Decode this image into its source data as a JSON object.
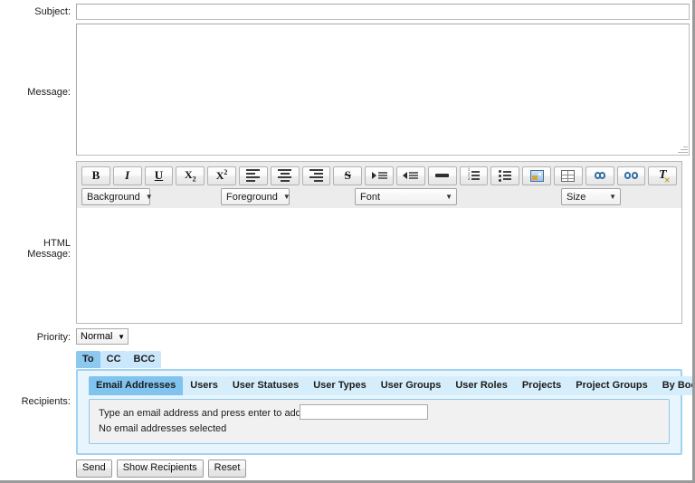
{
  "form": {
    "subject": {
      "label": "Subject:",
      "value": "",
      "placeholder": ""
    },
    "message": {
      "label": "Message:",
      "value": "",
      "placeholder": ""
    },
    "html_message": {
      "label": "HTML Message:",
      "value": ""
    },
    "priority": {
      "label": "Priority:",
      "value": "Normal",
      "caret": "▼"
    },
    "recipients": {
      "label": "Recipients:"
    }
  },
  "editor": {
    "buttons": [
      {
        "name": "bold-icon",
        "label": "B",
        "title": "Bold"
      },
      {
        "name": "italic-icon",
        "label": "I",
        "title": "Italic"
      },
      {
        "name": "underline-icon",
        "label": "U",
        "title": "Underline"
      },
      {
        "name": "subscript-icon",
        "label": "X2",
        "title": "Subscript"
      },
      {
        "name": "superscript-icon",
        "label": "X2",
        "title": "Superscript"
      },
      {
        "name": "align-left-icon",
        "label": "",
        "title": "Align Left"
      },
      {
        "name": "align-center-icon",
        "label": "",
        "title": "Align Center"
      },
      {
        "name": "align-right-icon",
        "label": "",
        "title": "Align Right"
      },
      {
        "name": "strikethrough-icon",
        "label": "S",
        "title": "Strikethrough"
      },
      {
        "name": "indent-icon",
        "label": "",
        "title": "Indent"
      },
      {
        "name": "outdent-icon",
        "label": "",
        "title": "Outdent"
      },
      {
        "name": "horizontal-rule-icon",
        "label": "",
        "title": "Horizontal Rule"
      },
      {
        "name": "numbered-list-icon",
        "label": "",
        "title": "Numbered List"
      },
      {
        "name": "bulleted-list-icon",
        "label": "",
        "title": "Bulleted List"
      },
      {
        "name": "insert-image-icon",
        "label": "",
        "title": "Insert Image"
      },
      {
        "name": "insert-table-icon",
        "label": "",
        "title": "Insert Table"
      },
      {
        "name": "insert-link-icon",
        "label": "",
        "title": "Insert Link"
      },
      {
        "name": "remove-link-icon",
        "label": "",
        "title": "Remove Link"
      },
      {
        "name": "remove-format-icon",
        "label": "T",
        "title": "Remove Formatting"
      }
    ],
    "selects": {
      "background": "Background",
      "foreground": "Foreground",
      "font": "Font",
      "size": "Size",
      "caret": "▼"
    }
  },
  "recipient_tabs": [
    {
      "label": "To",
      "active": true
    },
    {
      "label": "CC",
      "active": false
    },
    {
      "label": "BCC",
      "active": false
    }
  ],
  "recipient_subtabs": [
    {
      "label": "Email Addresses",
      "active": true
    },
    {
      "label": "Users",
      "active": false
    },
    {
      "label": "User Statuses",
      "active": false
    },
    {
      "label": "User Types",
      "active": false
    },
    {
      "label": "User Groups",
      "active": false
    },
    {
      "label": "User Roles",
      "active": false
    },
    {
      "label": "Projects",
      "active": false
    },
    {
      "label": "Project Groups",
      "active": false
    },
    {
      "label": "By Bookings",
      "active": false
    }
  ],
  "email_panel": {
    "hint": "Type an email address and press enter to add it",
    "input_value": "",
    "status": "No email addresses selected"
  },
  "actions": [
    {
      "name": "send-button",
      "label": "Send"
    },
    {
      "name": "show-recipients-button",
      "label": "Show Recipients"
    },
    {
      "name": "reset-button",
      "label": "Reset"
    }
  ],
  "colors": {
    "tab_active": "#8dc8ef",
    "tab_inactive": "#cbe7fb",
    "subtab_active": "#7fc3ee",
    "subtab_inactive": "#d6eefc",
    "panel_bg": "#e9f5fd",
    "panel_border": "#9fd3f3",
    "toolbar_bg": "#ececec"
  }
}
